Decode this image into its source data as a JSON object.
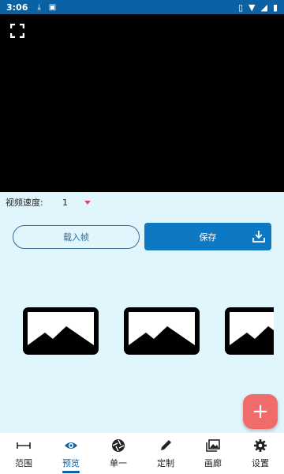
{
  "status_bar": {
    "time": "3:06"
  },
  "speed": {
    "label": "视频速度:",
    "value": "1"
  },
  "buttons": {
    "load_label": "载入帧",
    "save_label": "保存"
  },
  "nav": {
    "items": [
      {
        "label": "范围",
        "icon": "range-icon",
        "active": false
      },
      {
        "label": "预览",
        "icon": "eye-icon",
        "active": true
      },
      {
        "label": "单一",
        "icon": "shutter-icon",
        "active": false
      },
      {
        "label": "定制",
        "icon": "pencil-icon",
        "active": false
      },
      {
        "label": "画廊",
        "icon": "gallery-icon",
        "active": false
      },
      {
        "label": "设置",
        "icon": "gear-icon",
        "active": false
      }
    ]
  },
  "colors": {
    "accent": "#0a61a4",
    "save_button": "#0d78c4",
    "fab": "#f16b6b",
    "background": "#e0f6fc",
    "caret": "#e53f79"
  }
}
